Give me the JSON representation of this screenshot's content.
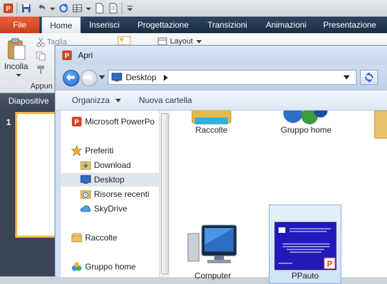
{
  "app": {
    "file_tab": "File",
    "tabs": [
      "Home",
      "Inserisci",
      "Progettazione",
      "Transizioni",
      "Animazioni",
      "Presentazione"
    ],
    "active_tab": "Home",
    "ribbon": {
      "paste": "Incolla",
      "cut": "Taglia",
      "layout": "Layout",
      "clipboard_group": "Appun"
    },
    "slides_panel": {
      "title": "Diapositive",
      "slide_number": "1"
    }
  },
  "dialog": {
    "title": "Apri",
    "address": "Desktop",
    "toolbar": {
      "organize": "Organizza",
      "new_folder": "Nuova cartella"
    },
    "nav": [
      {
        "label": "Microsoft PowerPo",
        "icon": "powerpoint-icon"
      },
      {
        "label": "Preferiti",
        "icon": "star-icon"
      },
      {
        "label": "Download",
        "icon": "download-folder-icon"
      },
      {
        "label": "Desktop",
        "icon": "desktop-icon",
        "selected": true
      },
      {
        "label": "Risorse recenti",
        "icon": "recent-places-icon"
      },
      {
        "label": "SkyDrive",
        "icon": "skydrive-icon"
      },
      {
        "label": "Raccolte",
        "icon": "libraries-icon"
      },
      {
        "label": "Gruppo home",
        "icon": "homegroup-icon"
      }
    ],
    "files": [
      {
        "label": "Raccolte",
        "icon": "libraries-icon"
      },
      {
        "label": "Gruppo home",
        "icon": "homegroup-icon"
      },
      {
        "label": "Computer",
        "icon": "computer-icon"
      },
      {
        "label": "PPauto",
        "icon": "presentation-file-icon",
        "selected": true
      }
    ]
  },
  "colors": {
    "file_tab": "#d84f28",
    "ribbon_dark": "#243754",
    "selection": "#cfe2f6",
    "slide_border": "#f4b74a"
  }
}
